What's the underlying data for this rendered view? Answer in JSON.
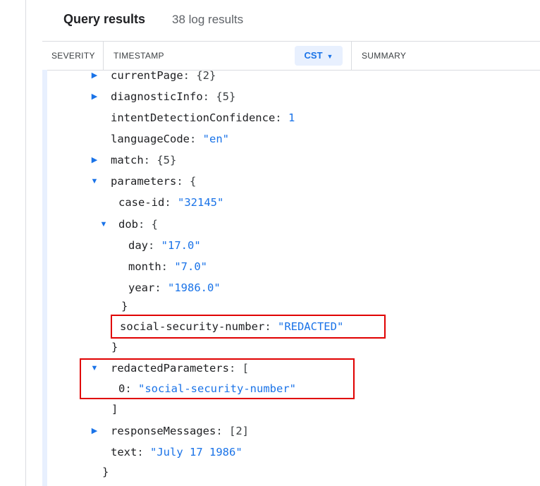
{
  "header": {
    "title": "Query results",
    "count": "38 log results"
  },
  "columns": {
    "severity": "SEVERITY",
    "timestamp": "TIMESTAMP",
    "timezone": "CST",
    "summary": "SUMMARY"
  },
  "lines": {
    "currentPage": {
      "key": "currentPage",
      "value": "{2}"
    },
    "diagnosticInfo": {
      "key": "diagnosticInfo",
      "value": "{5}"
    },
    "intent": {
      "key": "intentDetectionConfidence",
      "value": "1"
    },
    "language": {
      "key": "languageCode",
      "value": "\"en\""
    },
    "match": {
      "key": "match",
      "value": "{5}"
    },
    "parameters": {
      "key": "parameters",
      "value": "{"
    },
    "caseId": {
      "key": "case-id",
      "value": "\"32145\""
    },
    "dob": {
      "key": "dob",
      "value": "{"
    },
    "day": {
      "key": "day",
      "value": "\"17.0\""
    },
    "month": {
      "key": "month",
      "value": "\"7.0\""
    },
    "year": {
      "key": "year",
      "value": "\"1986.0\""
    },
    "dobClose": "}",
    "ssn": {
      "key": "social-security-number",
      "value": "\"REDACTED\""
    },
    "paramsClose": "}",
    "redacted": {
      "key": "redactedParameters",
      "value": "["
    },
    "redacted0": {
      "key": "0",
      "value": "\"social-security-number\""
    },
    "redactedClose": "]",
    "responseMessages": {
      "key": "responseMessages",
      "value": "[2]"
    },
    "text": {
      "key": "text",
      "value": "\"July 17 1986\""
    },
    "rootClose": "}"
  },
  "colors": {
    "accent": "#1a73e8",
    "highlight": "#e00000",
    "tzBg": "#e8f0fe"
  }
}
